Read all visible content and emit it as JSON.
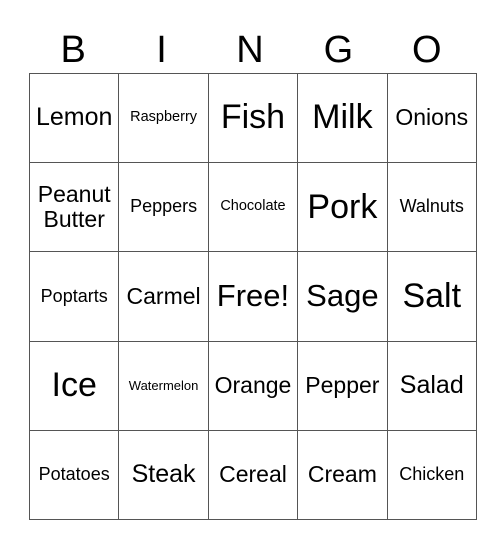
{
  "header": [
    "B",
    "I",
    "N",
    "G",
    "O"
  ],
  "rows": [
    [
      "Lemon",
      "Raspberry",
      "Fish",
      "Milk",
      "Onions"
    ],
    [
      "Peanut Butter",
      "Peppers",
      "Chocolate",
      "Pork",
      "Walnuts"
    ],
    [
      "Poptarts",
      "Carmel",
      "Free!",
      "Sage",
      "Salt"
    ],
    [
      "Ice",
      "Watermelon",
      "Orange",
      "Pepper",
      "Salad"
    ],
    [
      "Potatoes",
      "Steak",
      "Cereal",
      "Cream",
      "Chicken"
    ]
  ]
}
